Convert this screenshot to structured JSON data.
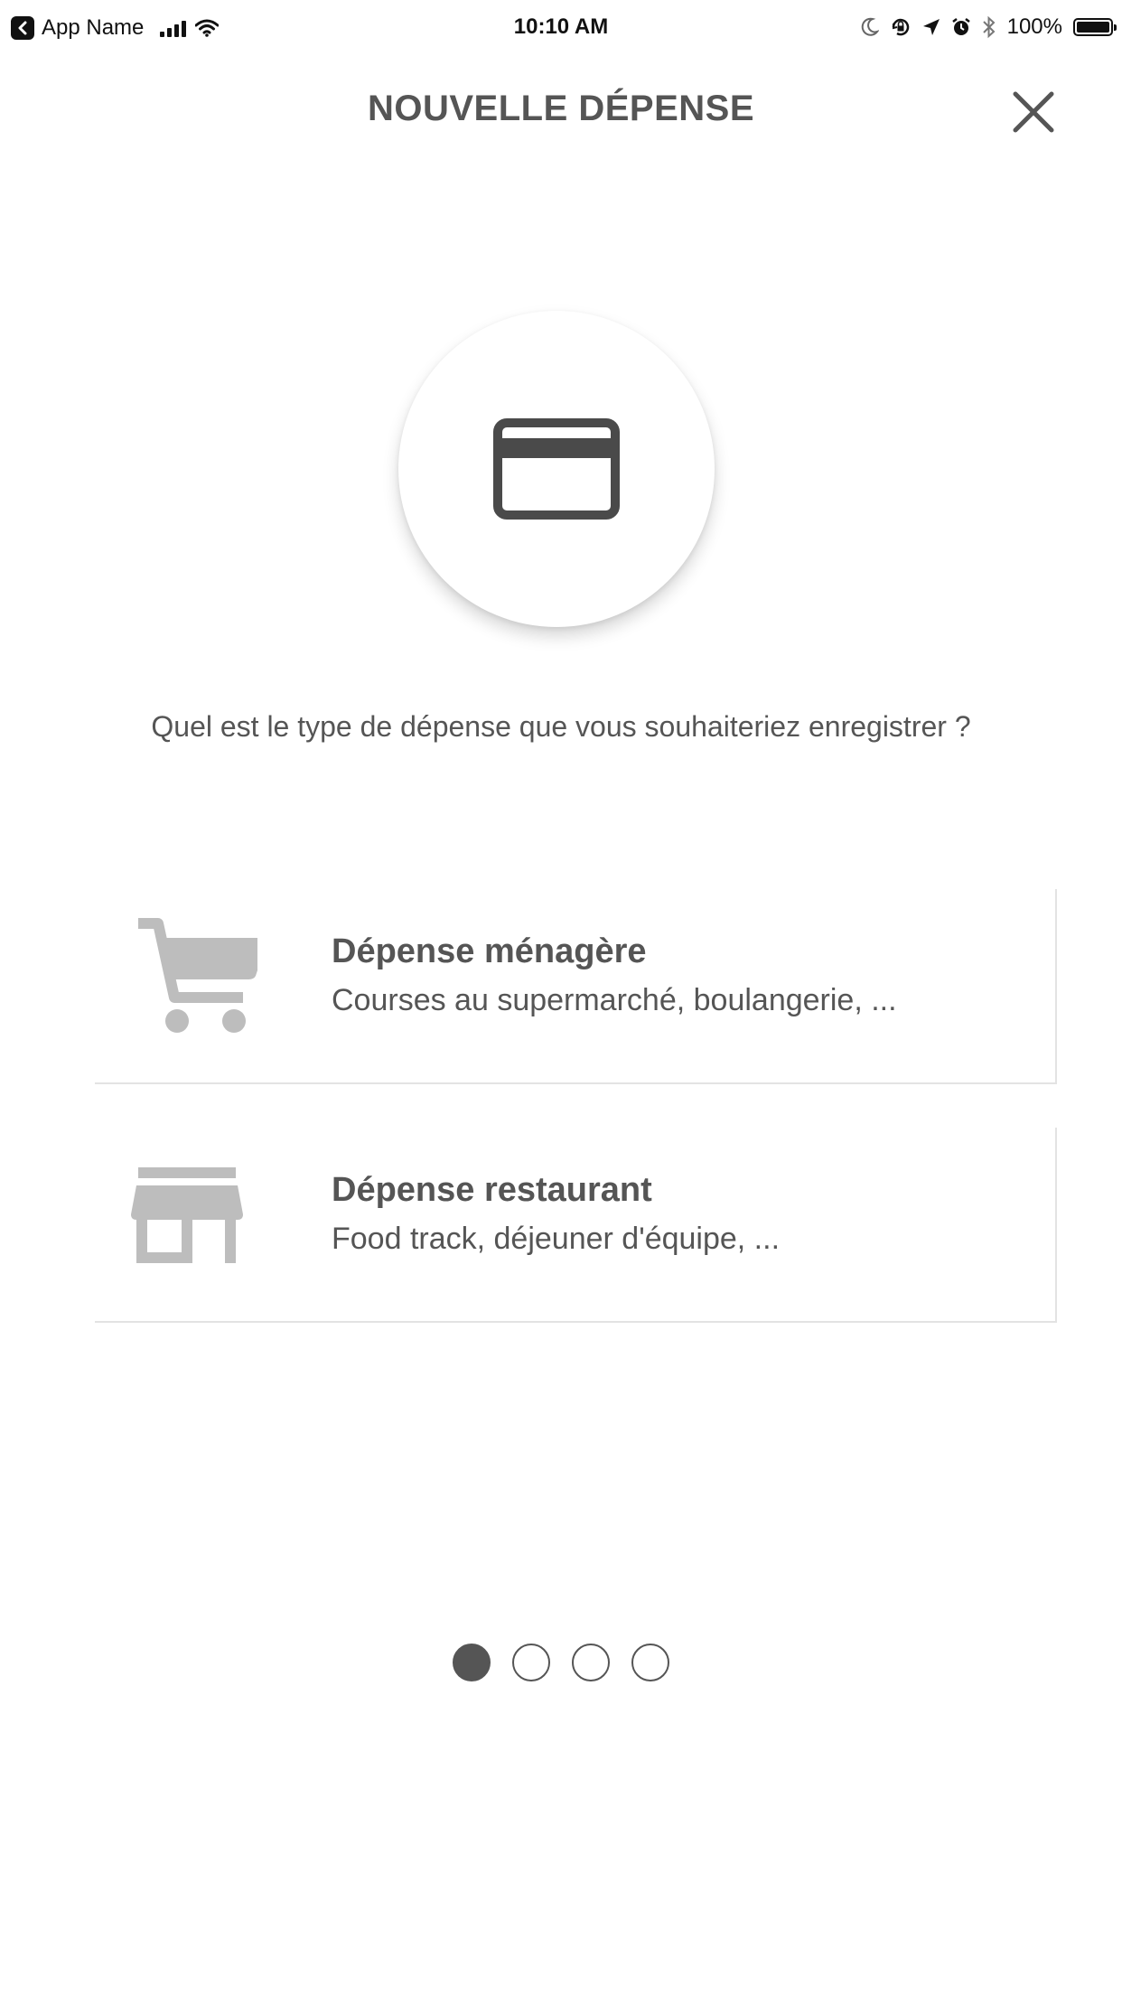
{
  "status_bar": {
    "app_name": "App Name",
    "time": "10:10 AM",
    "battery_percent": "100%"
  },
  "header": {
    "title": "NOUVELLE DÉPENSE",
    "close_icon": "close-icon"
  },
  "hero": {
    "icon": "credit-card-icon"
  },
  "question": "Quel est le type de dépense que vous souhaiteriez enregistrer ?",
  "options": [
    {
      "icon": "shopping-cart-icon",
      "label": "Dépense ménagère",
      "description": "Courses au supermarché, boulangerie, ..."
    },
    {
      "icon": "store-icon",
      "label": "Dépense restaurant",
      "description": "Food track, déjeuner d'équipe, ..."
    }
  ],
  "pager": {
    "total": 4,
    "current": 1
  },
  "colors": {
    "text": "#555555",
    "icon_gray": "#bdbdbd",
    "background": "#ffffff"
  }
}
